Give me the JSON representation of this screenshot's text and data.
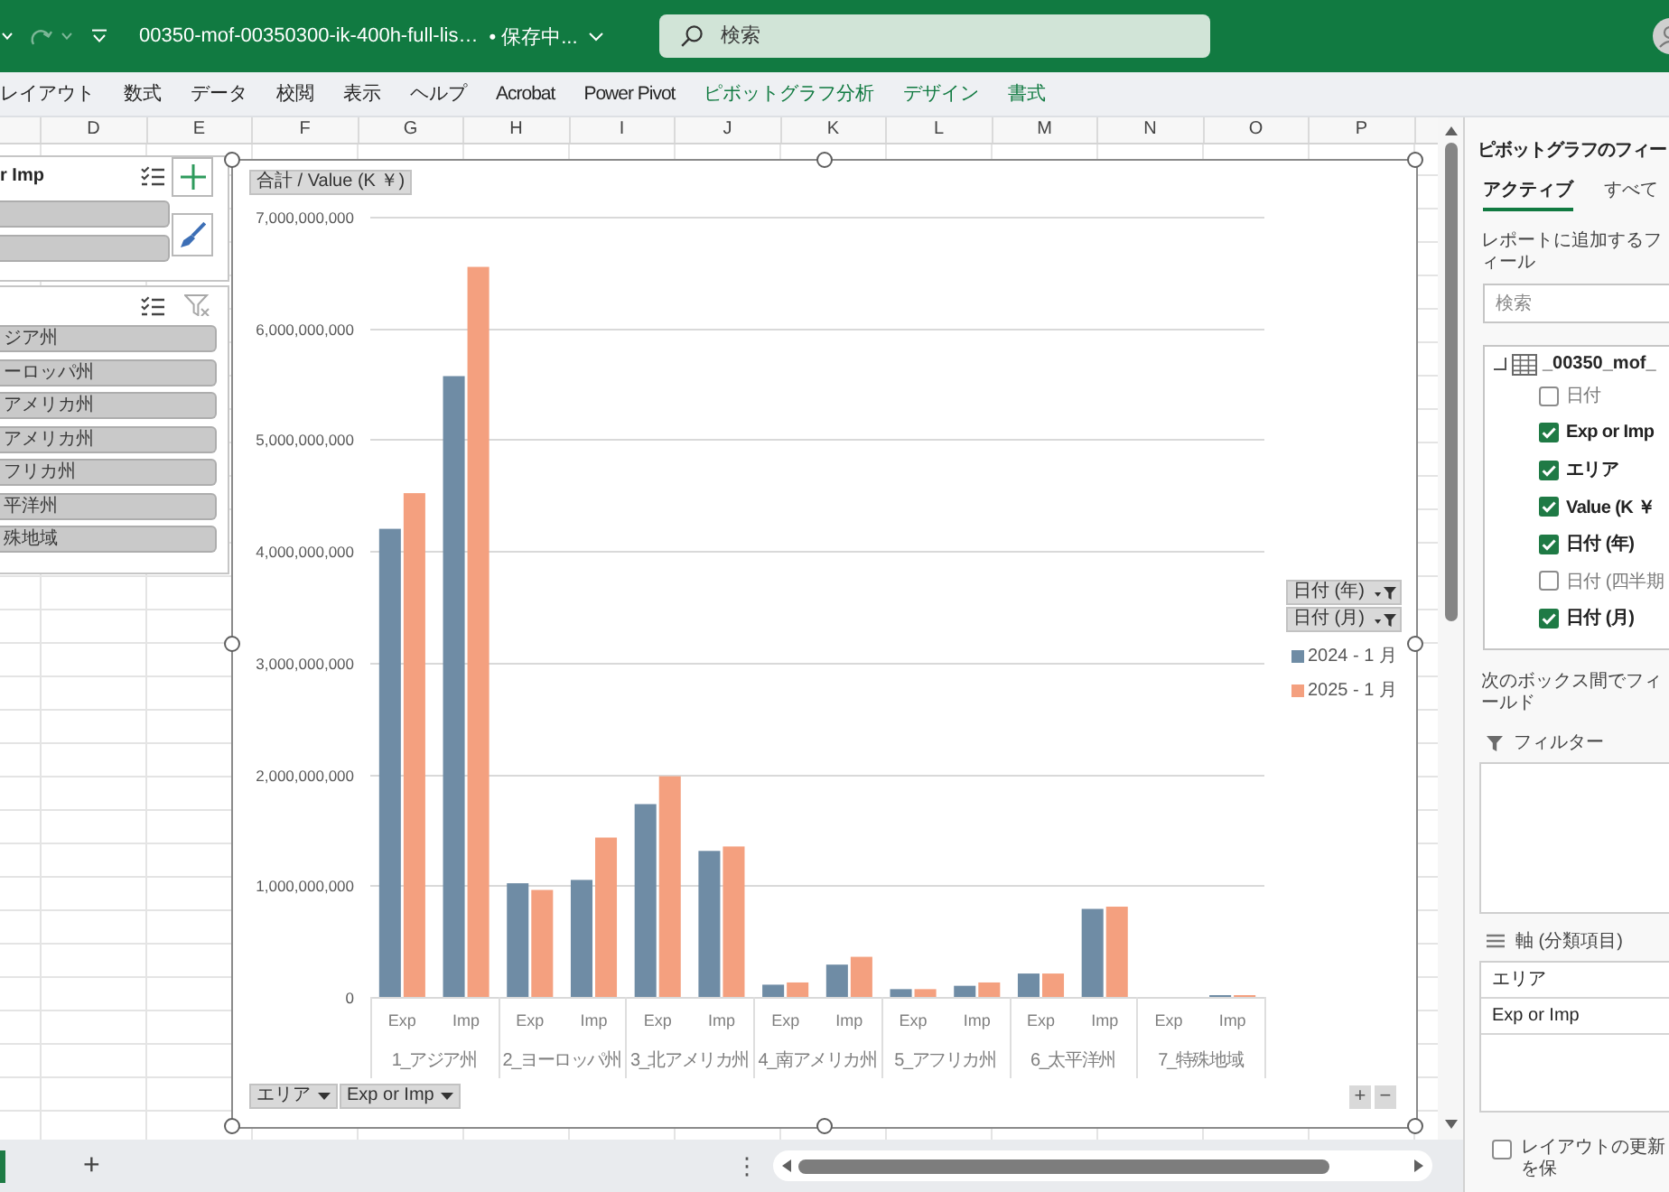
{
  "title_bar": {
    "redo": {
      "disabled": true
    },
    "file_name": "00350-mof-00350300-ik-400h-full-lis…",
    "save_status": "• 保存中...",
    "search": {
      "placeholder": "検索"
    }
  },
  "ribbon_tabs": [
    {
      "label": "レイアウト",
      "kind": "standard"
    },
    {
      "label": "数式",
      "kind": "standard"
    },
    {
      "label": "データ",
      "kind": "standard"
    },
    {
      "label": "校閲",
      "kind": "standard"
    },
    {
      "label": "表示",
      "kind": "standard"
    },
    {
      "label": "ヘルプ",
      "kind": "standard"
    },
    {
      "label": "Acrobat",
      "kind": "standard"
    },
    {
      "label": "Power Pivot",
      "kind": "standard"
    },
    {
      "label": "ピボットグラフ分析",
      "kind": "contextual"
    },
    {
      "label": "デザイン",
      "kind": "contextual"
    },
    {
      "label": "書式",
      "kind": "contextual"
    }
  ],
  "column_headers": [
    "D",
    "E",
    "F",
    "G",
    "H",
    "I",
    "J",
    "K",
    "L",
    "M",
    "N",
    "O",
    "P"
  ],
  "slicers": [
    {
      "header": "r Imp",
      "tools": [
        {
          "kind": "multi_select",
          "disabled": false
        }
      ],
      "items": [
        {
          "selected": true
        },
        {
          "selected": true
        }
      ]
    },
    {
      "tools": [
        {
          "kind": "multi_select",
          "disabled": false
        },
        {
          "kind": "clear_filter",
          "disabled": true
        }
      ],
      "items": [
        {
          "label": "ジア州",
          "selected": true
        },
        {
          "label": "ーロッパ州",
          "selected": true
        },
        {
          "label": "アメリカ州",
          "selected": true
        },
        {
          "label": "アメリカ州",
          "selected": true
        },
        {
          "label": "フリカ州",
          "selected": true
        },
        {
          "label": "平洋州",
          "selected": true
        },
        {
          "label": "殊地域",
          "selected": true
        }
      ]
    }
  ],
  "chart_tools": [
    {
      "kind": "elements"
    },
    {
      "kind": "styles"
    }
  ],
  "chart": {
    "value_field": "合計 / Value (K ￥)",
    "chart_data": {
      "type": "bar",
      "categories": [
        "Exp",
        "Imp",
        "Exp",
        "Imp",
        "Exp",
        "Imp",
        "Exp",
        "Imp",
        "Exp",
        "Imp",
        "Exp",
        "Imp",
        "Exp",
        "Imp"
      ],
      "series": [
        {
          "name": "2024 - 1 月",
          "color": "#6f8ca5",
          "values": [
            4200000000,
            5570000000,
            1020000000,
            1050000000,
            1730000000,
            1310000000,
            110000000,
            290000000,
            70000000,
            100000000,
            210000000,
            790000000,
            0,
            10000000
          ]
        },
        {
          "name": "2025 - 1 月",
          "color": "#f4a07f",
          "values": [
            4520000000,
            6550000000,
            960000000,
            1430000000,
            1980000000,
            1350000000,
            130000000,
            360000000,
            70000000,
            130000000,
            210000000,
            810000000,
            0,
            10000000
          ]
        }
      ],
      "ylim": [
        0,
        7000000000
      ],
      "yticks": [
        {
          "value": 0,
          "label": "0"
        },
        {
          "value": 1000000000,
          "label": "1,000,000,000"
        },
        {
          "value": 2000000000,
          "label": "2,000,000,000"
        },
        {
          "value": 3000000000,
          "label": "3,000,000,000"
        },
        {
          "value": 4000000000,
          "label": "4,000,000,000"
        },
        {
          "value": 5000000000,
          "label": "5,000,000,000"
        },
        {
          "value": 6000000000,
          "label": "6,000,000,000"
        },
        {
          "value": 7000000000,
          "label": "7,000,000,000"
        }
      ],
      "grid": true,
      "legend": "right"
    },
    "x_groups": [
      "1_アジア州",
      "2_ヨーロッパ州",
      "3_北アメリカ州",
      "4_南アメリカ州",
      "5_アフリカ州",
      "6_太平洋州",
      "7_特殊地域"
    ],
    "legend_fields": [
      "日付 (年)",
      "日付 (月)"
    ],
    "axis_fields": [
      "エリア",
      "Exp or Imp"
    ],
    "field_buttons": [
      "+",
      "−"
    ]
  },
  "sheet_bar": {
    "tabs": [
      {
        "selected": true
      }
    ],
    "new_sheet": "+",
    "split_handle": "⋮"
  },
  "field_list": {
    "title": "ピボットグラフのフィー",
    "tabs": [
      {
        "label": "アクティブ",
        "selected": true
      },
      {
        "label": "すべて",
        "selected": false
      }
    ],
    "prompt": "レポートに追加するフィール",
    "search": {
      "placeholder": "検索"
    },
    "table": {
      "name": "_00350_mof_",
      "expanded": true
    },
    "fields": [
      {
        "label": "日付",
        "checked": false
      },
      {
        "label": "Exp or Imp",
        "checked": true
      },
      {
        "label": "エリア",
        "checked": true
      },
      {
        "label": "Value (K ￥",
        "checked": true
      },
      {
        "label": "日付 (年)",
        "checked": true
      },
      {
        "label": "日付 (四半期",
        "checked": false
      },
      {
        "label": "日付 (月)",
        "checked": true
      }
    ],
    "areas_prompt": "次のボックス間でフィールド",
    "areas": [
      {
        "kind": "filter",
        "label": "フィルター"
      },
      {
        "kind": "axis",
        "label": "軸 (分類項目)",
        "items": [
          "エリア",
          "Exp or Imp"
        ]
      }
    ],
    "defer_update": {
      "label": "レイアウトの更新を保",
      "checked": false
    }
  }
}
